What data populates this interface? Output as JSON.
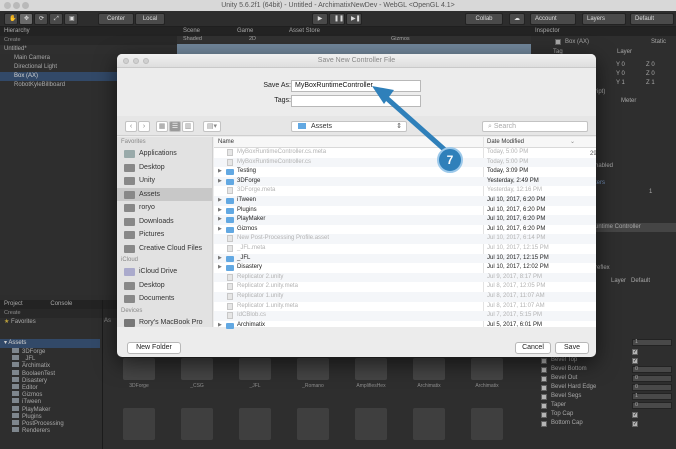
{
  "window": {
    "title": "Unity 5.6.2f1 (64bit) - Untitled - ArchimatixNewDev - WebGL <OpenGL 4.1>"
  },
  "toolbar": {
    "center": "Center",
    "local": "Local",
    "collab": "Collab",
    "account": "Account",
    "layers": "Layers",
    "layout": "Default"
  },
  "hierarchy": {
    "tab": "Hierarchy",
    "create": "Create",
    "search": "Q▾All",
    "scene": "Untitled*",
    "items": [
      "Main Camera",
      "Directional Light",
      "Box (AX)",
      "RobotKyleBillboard"
    ]
  },
  "sceneview": {
    "scene_tab": "Scene",
    "game_tab": "Game",
    "store_tab": "Asset Store",
    "shaded": "Shaded",
    "two_d": "2D",
    "gizmos": "Gizmos"
  },
  "inspector": {
    "tab": "Inspector",
    "object": "Box (AX)",
    "static": "Static",
    "tag": "Tag",
    "layer": "Layer",
    "y0a": "Y 0",
    "z0a": "Z 0",
    "y0b": "Y 0",
    "z0b": "Z 0",
    "y1": "Y 1",
    "z1": "Z 1",
    "ript": "ript)",
    "meter": "Meter",
    "enabled": "nabled",
    "ters": "ters",
    "one": "1",
    "controller": "untime Controller",
    "reflex": "reflex",
    "layer_default": "Default",
    "rows": [
      {
        "label": "Bevel Top",
        "value": "1",
        "checked": false
      },
      {
        "label": "",
        "value": "",
        "checked": true
      },
      {
        "label": "Bevel Top",
        "value": "",
        "checked": true
      },
      {
        "label": "Bevel Bottom",
        "value": "0",
        "checked": false
      },
      {
        "label": "Bevel Out",
        "value": "0",
        "checked": false
      },
      {
        "label": "Bevel Hard Edge",
        "value": "0",
        "checked": false
      },
      {
        "label": "Bevel Segs",
        "value": "1",
        "checked": false
      },
      {
        "label": "Taper",
        "value": "0",
        "checked": false
      },
      {
        "label": "Top Cap",
        "value": "",
        "checked": true
      },
      {
        "label": "Bottom Cap",
        "value": "",
        "checked": true
      }
    ]
  },
  "project": {
    "tab": "Project",
    "console_tab": "Console",
    "create": "Create",
    "favorites": "Favorites",
    "assets": "Assets",
    "crumb": "As",
    "tree": [
      "3DForge",
      "_JFL",
      "Archimatix",
      "BoolaenTest",
      "Disastery",
      "Editor",
      "Gizmos",
      "iTween",
      "PlayMaker",
      "Plugins",
      "PostProcessing",
      "Renderers"
    ],
    "thumbs": [
      "3DForge",
      "_CSG",
      "_JFL",
      "_Romano",
      "AmplifiesHex",
      "Archimatix",
      "Archimatix"
    ]
  },
  "dialog": {
    "title": "Save New Controller File",
    "save_as_label": "Save As:",
    "save_as_value": "MyBoxRuntimeController",
    "tags_label": "Tags:",
    "tags_value": "",
    "location": "Assets",
    "search_placeholder": "Search",
    "sidebar": {
      "favorites_head": "Favorites",
      "icloud_head": "iCloud",
      "devices_head": "Devices",
      "favorites": [
        "Applications",
        "Desktop",
        "Unity",
        "Assets",
        "roryo",
        "Downloads",
        "Pictures",
        "Creative Cloud Files"
      ],
      "icloud": [
        "iCloud Drive",
        "Desktop",
        "Documents"
      ],
      "devices": [
        "Rory's MacBook Pro"
      ]
    },
    "col_name": "Name",
    "col_date": "Date Modified",
    "files": [
      {
        "name": "MyBoxRuntimeController.cs.meta",
        "date": "Today, 5:00 PM",
        "folder": false,
        "enabled": false
      },
      {
        "name": "MyBoxRuntimeController.cs",
        "date": "Today, 5:00 PM",
        "folder": false,
        "enabled": false
      },
      {
        "name": "Testing",
        "date": "Today, 3:09 PM",
        "folder": true,
        "enabled": true
      },
      {
        "name": "3DForge",
        "date": "Yesterday, 2:49 PM",
        "folder": true,
        "enabled": true
      },
      {
        "name": "3DForge.meta",
        "date": "Yesterday, 12:16 PM",
        "folder": false,
        "enabled": false
      },
      {
        "name": "iTween",
        "date": "Jul 10, 2017, 6:20 PM",
        "folder": true,
        "enabled": true
      },
      {
        "name": "Plugins",
        "date": "Jul 10, 2017, 6:20 PM",
        "folder": true,
        "enabled": true
      },
      {
        "name": "PlayMaker",
        "date": "Jul 10, 2017, 6:20 PM",
        "folder": true,
        "enabled": true
      },
      {
        "name": "Gizmos",
        "date": "Jul 10, 2017, 6:20 PM",
        "folder": true,
        "enabled": true
      },
      {
        "name": "New Post-Processing Profile.asset",
        "date": "Jul 10, 2017, 6:14 PM",
        "folder": false,
        "enabled": false
      },
      {
        "name": "_JFL.meta",
        "date": "Jul 10, 2017, 12:15 PM",
        "folder": false,
        "enabled": false
      },
      {
        "name": "_JFL",
        "date": "Jul 10, 2017, 12:15 PM",
        "folder": true,
        "enabled": true
      },
      {
        "name": "Disastery",
        "date": "Jul 10, 2017, 12:02 PM",
        "folder": true,
        "enabled": true
      },
      {
        "name": "Replicator 2.unity",
        "date": "Jul 9, 2017, 8:17 PM",
        "folder": false,
        "enabled": false
      },
      {
        "name": "Replicator 2.unity.meta",
        "date": "Jul 8, 2017, 12:05 PM",
        "folder": false,
        "enabled": false
      },
      {
        "name": "Replicator 1.unity",
        "date": "Jul 8, 2017, 11:07 AM",
        "folder": false,
        "enabled": false
      },
      {
        "name": "Replicator 1.unity.meta",
        "date": "Jul 8, 2017, 11:07 AM",
        "folder": false,
        "enabled": false
      },
      {
        "name": "IdCBlob.cs",
        "date": "Jul 7, 2017, 5:15 PM",
        "folder": false,
        "enabled": false
      },
      {
        "name": "Archimatix",
        "date": "Jul 5, 2017, 6:01 PM",
        "folder": true,
        "enabled": true
      }
    ],
    "side_date": "29",
    "new_folder": "New Folder",
    "cancel": "Cancel",
    "save": "Save"
  },
  "annotation": {
    "step": "7"
  },
  "colors": {
    "accent": "#2f80ba",
    "folder": "#62a8e2",
    "selection": "#3d5a7f"
  }
}
